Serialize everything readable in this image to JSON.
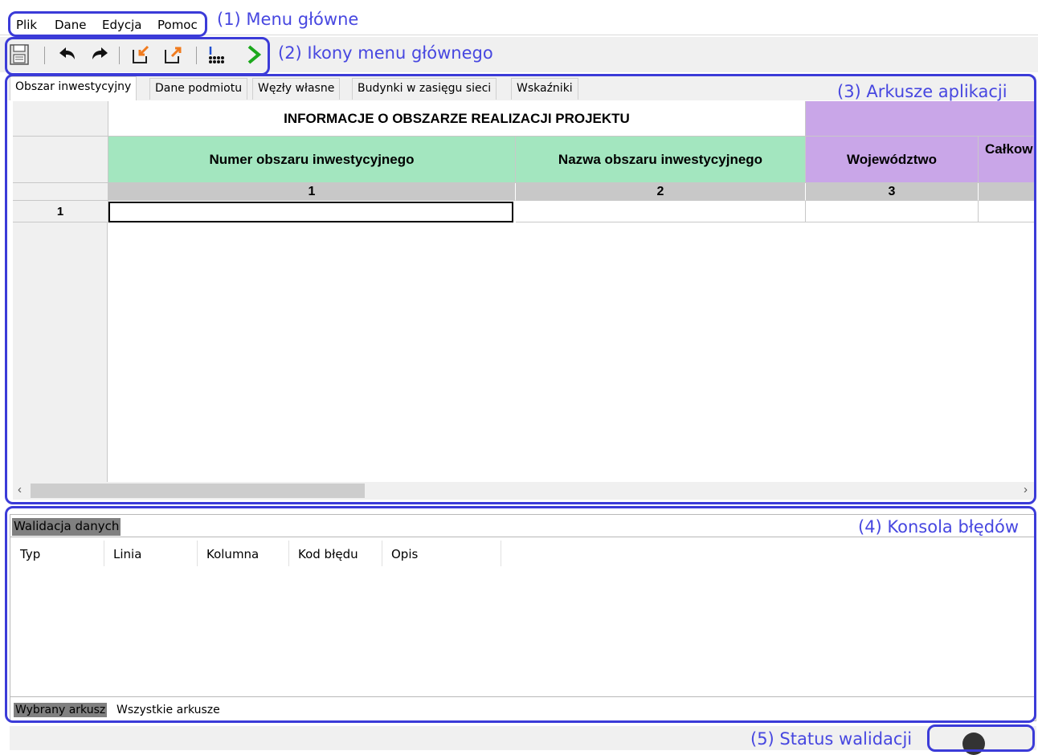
{
  "menu": {
    "items": [
      "Plik",
      "Dane",
      "Edycja",
      "Pomoc"
    ]
  },
  "toolbar": {
    "icons": [
      "save-icon",
      "undo-icon",
      "redo-icon",
      "import-icon",
      "export-icon",
      "table-icon",
      "run-icon"
    ]
  },
  "tabs": {
    "items": [
      "Obszar inwestycyjny",
      "Dane podmiotu",
      "Węzły własne",
      "Budynki w zasięgu sieci",
      "Wskaźniki"
    ],
    "active": "Obszar inwestycyjny"
  },
  "grid": {
    "section_title": "INFORMACJE O OBSZARZE REALIZACJI PROJEKTU",
    "columns": [
      {
        "label": "Numer obszaru inwestycyjnego",
        "number": "1"
      },
      {
        "label": "Nazwa obszaru inwestycyjnego",
        "number": "2"
      },
      {
        "label": "Województwo",
        "number": "3"
      },
      {
        "label": "Całkow",
        "number": ""
      }
    ],
    "rows": [
      "1"
    ],
    "colors": {
      "green_header": "#a3e6bf",
      "purple_header": "#c9a6e8",
      "number_row": "#c8c8c8"
    }
  },
  "console": {
    "title": "Walidacja danych",
    "columns": [
      "Typ",
      "Linia",
      "Kolumna",
      "Kod błędu",
      "Opis"
    ],
    "bottom_tabs": [
      "Wybrany arkusz",
      "Wszystkie arkusze"
    ]
  },
  "annotations": {
    "menu": "(1) Menu główne",
    "toolbar": "(2) Ikony menu głównego",
    "sheets": "(3) Arkusze aplikacji",
    "console": "(4) Konsola błędów",
    "status": "(5) Status walidacji",
    "color": "#3b3bd8"
  }
}
